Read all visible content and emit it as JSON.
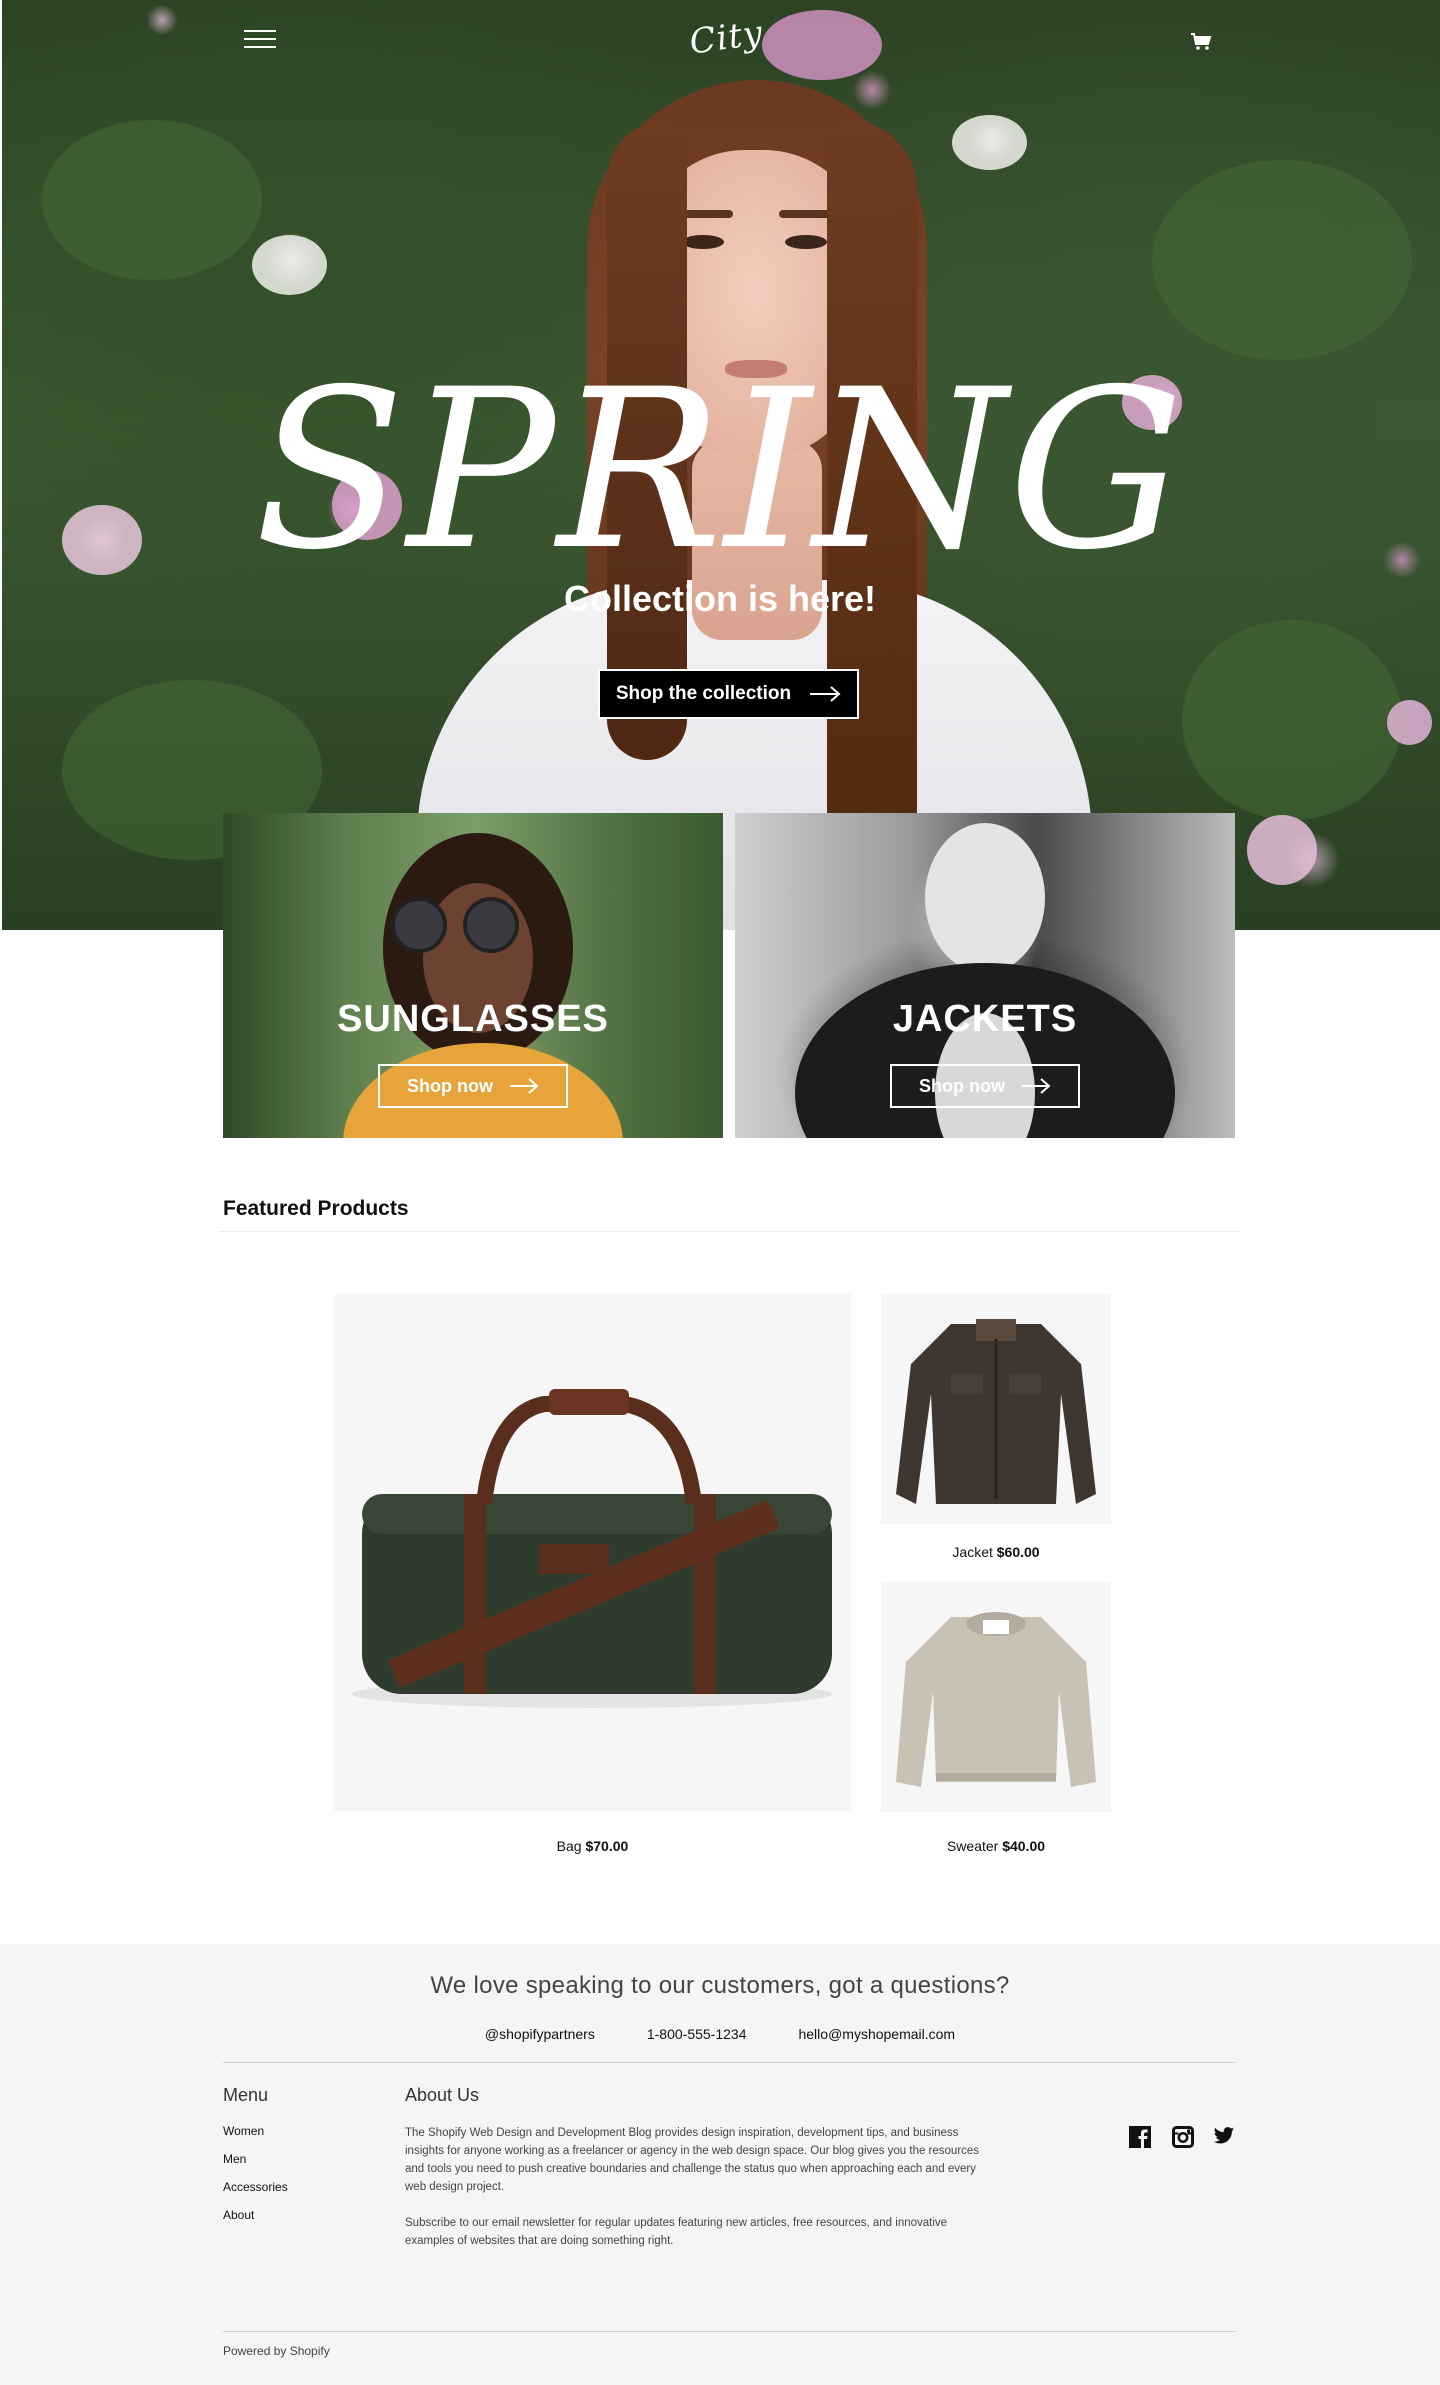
{
  "header": {
    "logo_text": "City",
    "menu_icon": "hamburger-menu-icon",
    "cart_icon": "cart-icon"
  },
  "hero": {
    "title": "SPRING",
    "subtitle": "Collection is here!",
    "button_label": "Shop the collection",
    "button_icon": "arrow-right-icon"
  },
  "categories": [
    {
      "title": "SUNGLASSES",
      "button_label": "Shop now"
    },
    {
      "title": "JACKETS",
      "button_label": "Shop now"
    }
  ],
  "featured": {
    "heading": "Featured Products",
    "products": [
      {
        "name": "Bag",
        "price": "$70.00"
      },
      {
        "name": "Jacket",
        "price": "$60.00"
      },
      {
        "name": "Sweater",
        "price": "$40.00"
      }
    ]
  },
  "footer": {
    "tagline": "We love speaking to our customers, got a questions?",
    "contacts": {
      "social_handle": "@shopifypartners",
      "phone": "1-800-555-1234",
      "email": "hello@myshopemail.com"
    },
    "menu": {
      "title": "Menu",
      "items": [
        "Women",
        "Men",
        "Accessories",
        "About"
      ]
    },
    "about": {
      "title": "About Us",
      "paragraph1": "The Shopify Web Design and Development Blog provides design inspiration, development tips, and business insights for anyone working as a freelancer or agency in the web design space. Our blog gives you the resources and tools you need to push creative boundaries and challenge the status quo when approaching each and every web design project.",
      "paragraph2": "Subscribe to our email newsletter for regular updates featuring new articles, free resources, and innovative examples of websites that are doing something right."
    },
    "social_icons": [
      "facebook-icon",
      "instagram-icon",
      "twitter-icon"
    ],
    "powered_by": "Powered by Shopify"
  },
  "colors": {
    "accent": "#000000",
    "footer_bg": "#f5f5f5",
    "product_bg": "#f6f6f6"
  }
}
